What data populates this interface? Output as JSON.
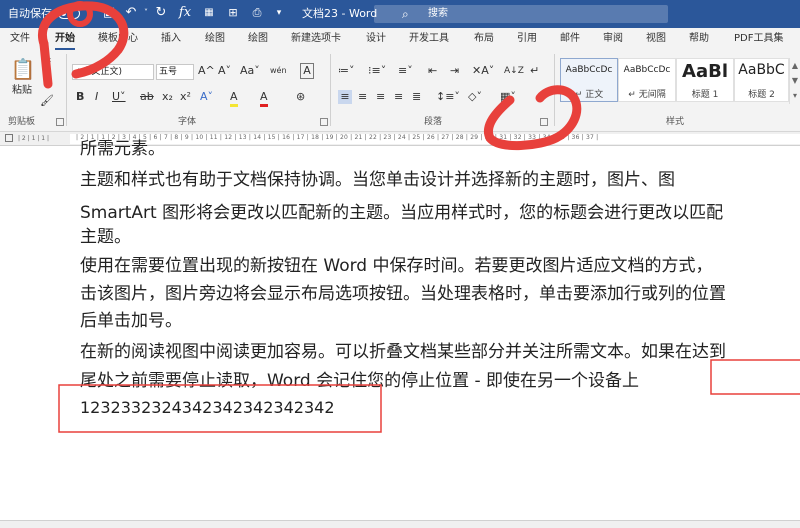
{
  "titlebar": {
    "autosave_label": "自动保存",
    "doc_title": "文档23 - Word",
    "search_placeholder": "搜索",
    "qat": [
      "save-icon",
      "undo-icon",
      "redo-icon",
      "formula-icon",
      "grid-icon",
      "structure-icon",
      "print-icon",
      "dropdown-icon"
    ]
  },
  "tabs": [
    "文件",
    "开始",
    "模板中心",
    "插入",
    "绘图",
    "绘图",
    "新建选项卡",
    "设计",
    "开发工具",
    "布局",
    "引用",
    "邮件",
    "审阅",
    "视图",
    "帮助",
    "PDF工具集"
  ],
  "active_tab": "开始",
  "ribbon": {
    "paste_label": "粘贴",
    "font_name": "+中文正文)",
    "font_size": "五号",
    "font_buttons_row1": [
      "A^",
      "A˅",
      "Aa˅",
      "wén",
      "A"
    ],
    "font_buttons_row2": [
      "B",
      "I",
      "U˅",
      "ab",
      "x₂",
      "x²",
      "A˅",
      "A",
      "A",
      "⊛"
    ],
    "para_buttons_row1": [
      "≔˅",
      "⁝≡˅",
      "≡˅",
      "⇤",
      "⇥",
      "✕A˅",
      "A↓Z",
      "↵"
    ],
    "para_buttons_row2": [
      "≡",
      "≡",
      "≡",
      "≡",
      "≣",
      "↕≡˅",
      "◇˅",
      "▦˅"
    ],
    "groups": {
      "clipboard": "剪贴板",
      "font": "字体",
      "paragraph": "段落",
      "styles": "样式"
    },
    "styles": [
      {
        "sample": "AaBbCcDc",
        "label": "↵ 正文"
      },
      {
        "sample": "AaBbCcDc",
        "label": "↵ 无间隔"
      },
      {
        "sample": "AaBl",
        "label": "标题 1"
      },
      {
        "sample": "AaBbC",
        "label": "标题 2"
      }
    ]
  },
  "ruler": {
    "text": "| 2 | 1 | 1 | 2 | 3 | 4 | 5 | 6 | 7 | 8 | 9 | 10 | 11 | 12 | 13 | 14 | 15 | 16 | 17 | 18 | 19 | 20 | 21 | 22 | 23 | 24 | 25 | 26 | 27 | 28 | 29 | 30 | 31 | 32 | 33 | 34 | 35 | 36 | 37 |",
    "left_text": "| 2 | 1 | 1 |"
  },
  "document": {
    "lines": [
      "所需元素。",
      "主题和样式也有助于文档保持协调。当您单击设计并选择新的主题时，图片、图",
      "SmartArt 图形将会更改以匹配新的主题。当应用样式时，您的标题会进行更改以匹配",
      "主题。",
      "使用在需要位置出现的新按钮在 Word 中保存时间。若要更改图片适应文档的方式，",
      "击该图片，图片旁边将会显示布局选项按钮。当处理表格时，单击要添加行或列的位置",
      "后单击加号。",
      "在新的阅读视图中阅读更加容易。可以折叠文档某些部分并关注所需文本。如果在达到",
      "尾处之前需要停止读取，Word 会记住您的停止位置 - 即使在另一个设备上",
      "1232332324342342342342342"
    ]
  },
  "colors": {
    "titlebar": "#2b579a",
    "ribbon": "#f3f3f3",
    "annotation_red": "#e8403b"
  }
}
